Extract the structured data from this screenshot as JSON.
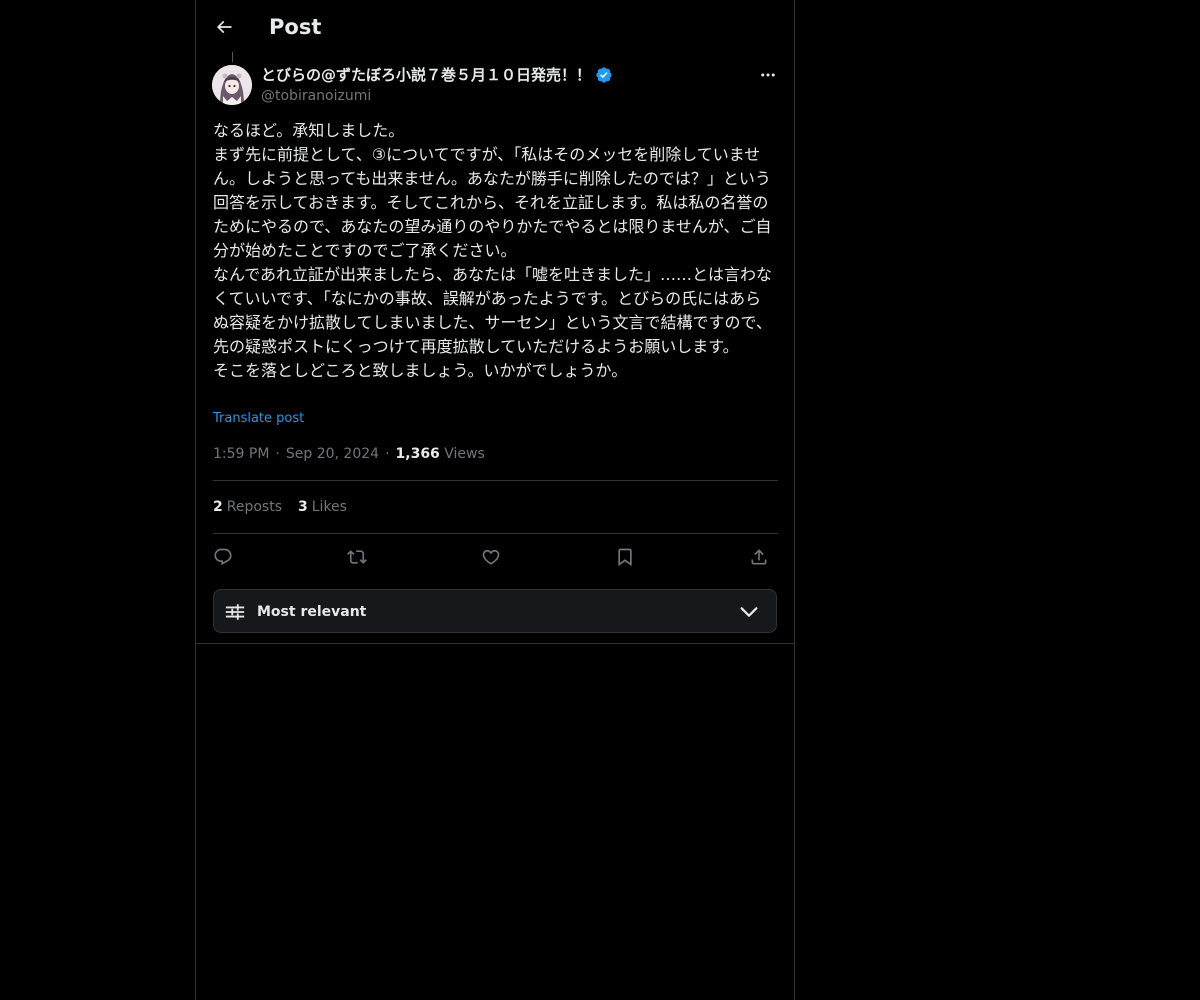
{
  "header": {
    "title": "Post",
    "back_icon": "arrow-left-icon"
  },
  "post": {
    "author": {
      "display_name": "とびらの@ずたぼろ小説７巻５月１０日発売！！",
      "handle": "@tobiranoizumi",
      "verified": true,
      "verified_color": "#1d9bf0"
    },
    "body": "なるほど。承知しました。\nまず先に前提として、③についてですが、「私はそのメッセを削除していません。しようと思っても出来ません。あなたが勝手に削除したのでは？」という回答を示しておきます。そしてこれから、それを立証します。私は私の名誉のためにやるので、あなたの望み通りのやりかたでやるとは限りませんが、ご自分が始めたことですのでご了承ください。\nなんであれ立証が出来ましたら、あなたは「嘘を吐きました」……とは言わなくていいです、「なにかの事故、誤解があったようです。とびらの氏にはあらぬ容疑をかけ拡散してしまいました、サーセン」という文言で結構ですので、先の疑惑ポストにくっつけて再度拡散していただけるようお願いします。\nそこを落としどころと致しましょう。いかがでしょうか。",
    "translate_label": "Translate post",
    "time": "1:59 PM",
    "date": "Sep 20, 2024",
    "views_count": "1,366",
    "views_label": "Views",
    "reposts_count": "2",
    "reposts_label": "Reposts",
    "likes_count": "3",
    "likes_label": "Likes"
  },
  "actions": [
    "reply-icon",
    "repost-icon",
    "like-icon",
    "bookmark-icon",
    "share-icon"
  ],
  "replies_sort": {
    "label": "Most relevant"
  },
  "colors": {
    "background": "#000000",
    "text": "#e7e9ea",
    "muted": "#71767b",
    "accent": "#1d9bf0",
    "border": "#2f3336"
  }
}
